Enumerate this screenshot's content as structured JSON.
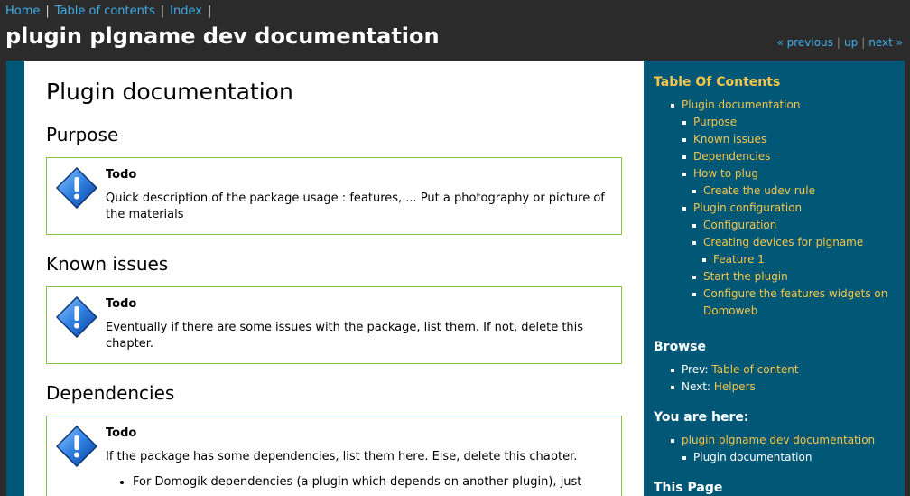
{
  "topnav": {
    "home": "Home",
    "toc": "Table of contents",
    "index": "Index",
    "sep": "|"
  },
  "site_title": "plugin plgname dev documentation",
  "relnav": {
    "previous": "« previous",
    "up": "up",
    "next": "next »",
    "sep": "|"
  },
  "main": {
    "page_title": "Plugin documentation",
    "sections": [
      {
        "heading": "Purpose",
        "admon_title": "Todo",
        "admon_text": "Quick description of the package usage : features, ... Put a photography or picture of the materials"
      },
      {
        "heading": "Known issues",
        "admon_title": "Todo",
        "admon_text": "Eventually if there are some issues with the package, list them. If not, delete this chapter."
      },
      {
        "heading": "Dependencies",
        "admon_title": "Todo",
        "admon_text": "If the package has some dependencies, list them here. Else, delete this chapter.",
        "admon_bullet": "For Domogik dependencies (a plugin which depends on another plugin), just"
      }
    ]
  },
  "sidebar": {
    "toc_title": "Table Of Contents",
    "toc": {
      "root": "Plugin documentation",
      "purpose": "Purpose",
      "known_issues": "Known issues",
      "dependencies": "Dependencies",
      "how_to_plug": "How to plug",
      "create_udev": "Create the udev rule",
      "plugin_configuration": "Plugin configuration",
      "configuration": "Configuration",
      "creating_devices": "Creating devices for plgname",
      "feature1": "Feature 1",
      "start_plugin": "Start the plugin",
      "configure_widgets": "Configure the features widgets on Domoweb"
    },
    "browse_title": "Browse",
    "browse": {
      "prev_label": "Prev:",
      "prev_link": "Table of content",
      "next_label": "Next:",
      "next_link": "Helpers"
    },
    "here_title": "You are here:",
    "here": {
      "root": "plugin plgname dev documentation",
      "current": "Plugin documentation"
    },
    "this_page_title": "This Page"
  },
  "colors": {
    "header_bg": "#2b2b2b",
    "sidebar_bg": "#015776",
    "link_blue": "#3daee9",
    "link_yellow": "#f5c448",
    "admon_border": "#86c142"
  }
}
